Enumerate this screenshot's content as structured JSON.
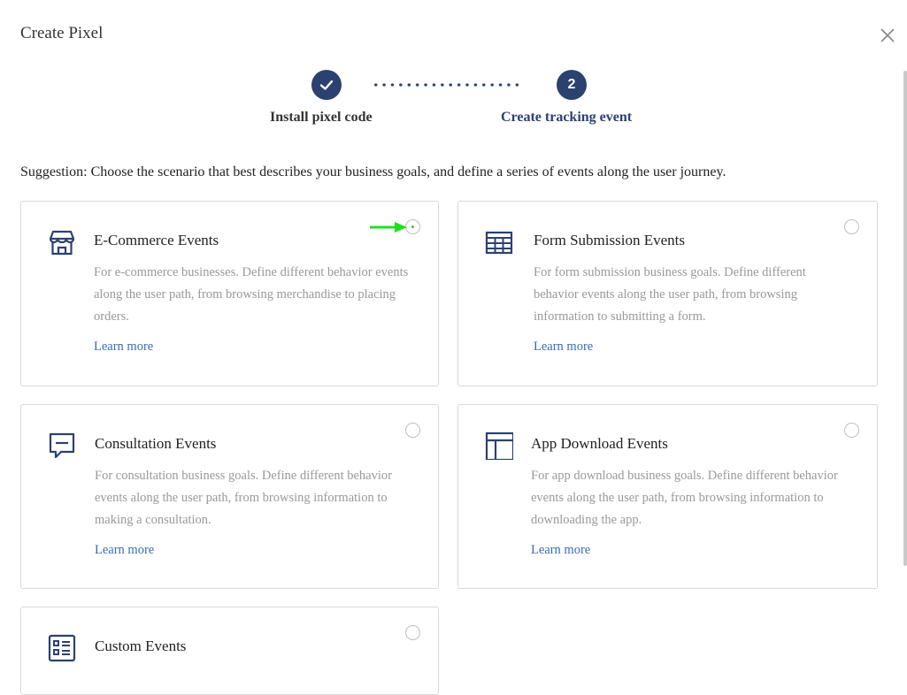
{
  "dialog": {
    "title": "Create Pixel"
  },
  "steps": [
    {
      "number": "✓",
      "label": "Install pixel code",
      "state": "completed"
    },
    {
      "number": "2",
      "label": "Create tracking event",
      "state": "active"
    }
  ],
  "suggestion": "Suggestion: Choose the scenario that best describes your business goals, and define a series of events along the user journey.",
  "cards": [
    {
      "title": "E-Commerce Events",
      "icon": "store-icon",
      "desc": "For e-commerce businesses. Define different behavior events along the user path, from browsing merchandise to placing orders.",
      "learn": "Learn more"
    },
    {
      "title": "Form Submission Events",
      "icon": "form-grid-icon",
      "desc": "For form submission business goals. Define different behavior events along the user path, from browsing information to submitting a form.",
      "learn": "Learn more"
    },
    {
      "title": "Consultation Events",
      "icon": "chat-bubble-icon",
      "desc": "For consultation business goals. Define different behavior events along the user path, from browsing information to making a consultation.",
      "learn": "Learn more"
    },
    {
      "title": "App Download Events",
      "icon": "app-layout-icon",
      "desc": "For app download business goals. Define different behavior events along the user path, from browsing information to downloading the app.",
      "learn": "Learn more"
    },
    {
      "title": "Custom Events",
      "icon": "custom-list-icon",
      "desc": "",
      "learn": ""
    }
  ],
  "colors": {
    "primary": "#2b4170",
    "link": "#3a6bb0",
    "muted_text": "#999999",
    "card_border": "#d9d9d9",
    "pointer_arrow": "#22dd22"
  }
}
